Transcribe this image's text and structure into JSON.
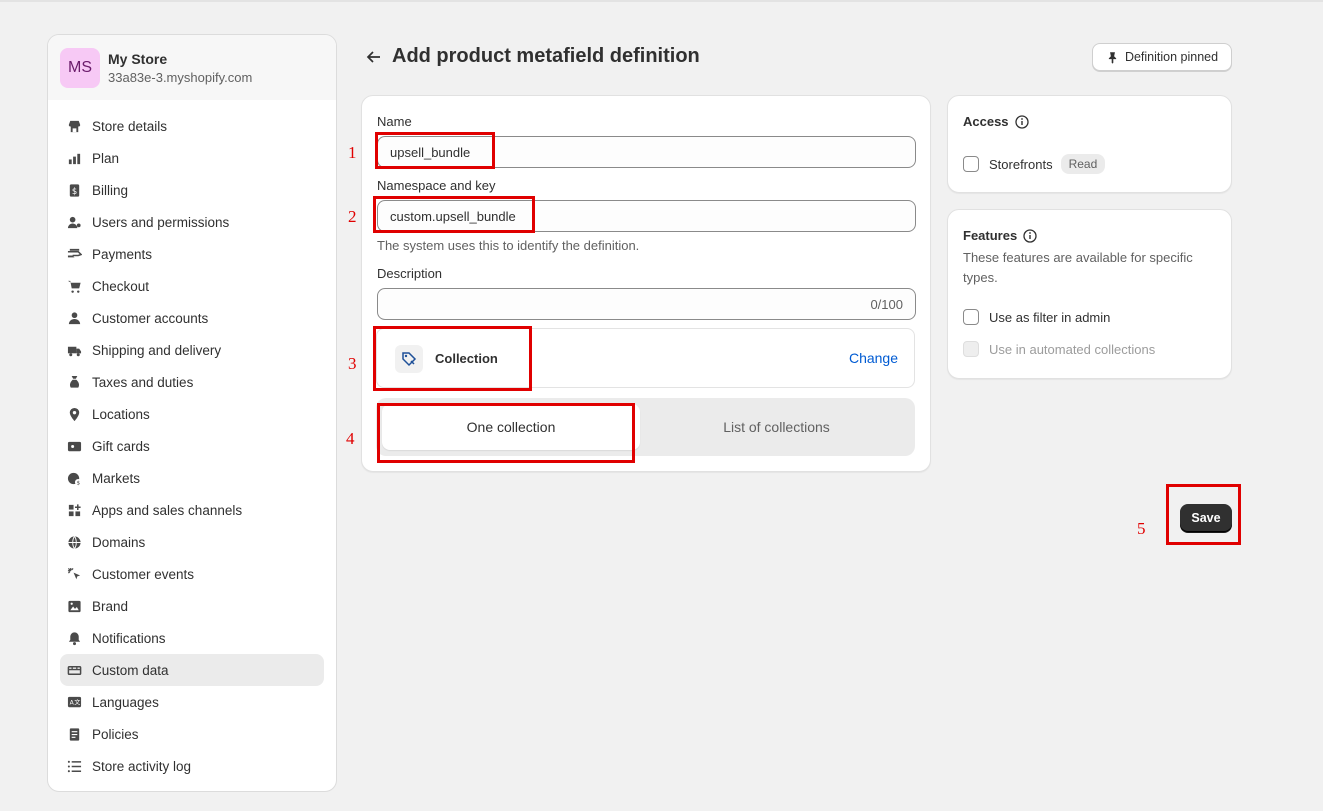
{
  "store": {
    "initials": "MS",
    "name": "My Store",
    "url": "33a83e-3.myshopify.com"
  },
  "sidebar": {
    "items": [
      {
        "label": "Store details",
        "icon": "store-icon"
      },
      {
        "label": "Plan",
        "icon": "plan-icon"
      },
      {
        "label": "Billing",
        "icon": "billing-icon"
      },
      {
        "label": "Users and permissions",
        "icon": "users-icon"
      },
      {
        "label": "Payments",
        "icon": "payments-icon"
      },
      {
        "label": "Checkout",
        "icon": "cart-icon"
      },
      {
        "label": "Customer accounts",
        "icon": "person-icon"
      },
      {
        "label": "Shipping and delivery",
        "icon": "truck-icon"
      },
      {
        "label": "Taxes and duties",
        "icon": "tax-icon"
      },
      {
        "label": "Locations",
        "icon": "location-icon"
      },
      {
        "label": "Gift cards",
        "icon": "gift-card-icon"
      },
      {
        "label": "Markets",
        "icon": "globe-dollar-icon"
      },
      {
        "label": "Apps and sales channels",
        "icon": "apps-icon"
      },
      {
        "label": "Domains",
        "icon": "globe-icon"
      },
      {
        "label": "Customer events",
        "icon": "cursor-icon"
      },
      {
        "label": "Brand",
        "icon": "brand-icon"
      },
      {
        "label": "Notifications",
        "icon": "bell-icon"
      },
      {
        "label": "Custom data",
        "icon": "custom-data-icon",
        "active": true
      },
      {
        "label": "Languages",
        "icon": "language-icon"
      },
      {
        "label": "Policies",
        "icon": "policies-icon"
      },
      {
        "label": "Store activity log",
        "icon": "list-icon"
      }
    ]
  },
  "header": {
    "title": "Add product metafield definition",
    "pinned_label": "Definition pinned"
  },
  "form": {
    "name_label": "Name",
    "name_value": "upsell_bundle",
    "namespace_label": "Namespace and key",
    "namespace_value": "custom.upsell_bundle",
    "namespace_help": "The system uses this to identify the definition.",
    "description_label": "Description",
    "description_value": "",
    "description_counter": "0/100",
    "type_label": "Collection",
    "change_label": "Change",
    "option_one": "One collection",
    "option_list": "List of collections"
  },
  "access": {
    "title": "Access",
    "storefronts_label": "Storefronts",
    "storefronts_badge": "Read",
    "storefronts_checked": false
  },
  "features": {
    "title": "Features",
    "description": "These features are available for specific types.",
    "filter_label": "Use as filter in admin",
    "filter_checked": false,
    "automated_label": "Use in automated collections",
    "automated_disabled": true
  },
  "save_label": "Save",
  "annotations": [
    "1",
    "2",
    "3",
    "4",
    "5"
  ],
  "colors": {
    "accent_link": "#005bd3",
    "annotation": "#e00000",
    "save_bg": "#303030"
  }
}
